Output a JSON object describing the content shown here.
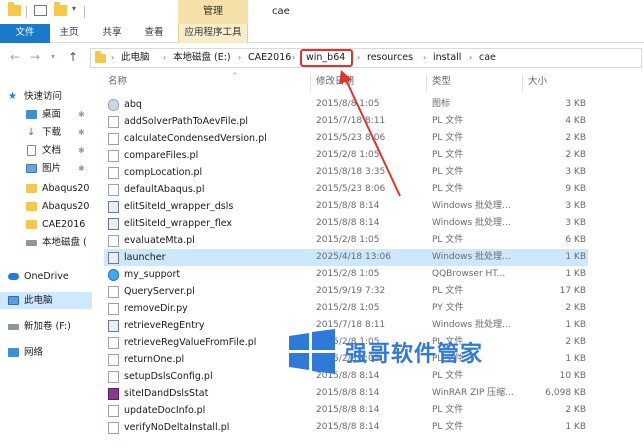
{
  "titlebar": {
    "context_group": "管理",
    "window_title": "cae"
  },
  "ribbon": {
    "tabs": [
      "文件",
      "主页",
      "共享",
      "查看",
      "应用程序工具"
    ]
  },
  "address": {
    "crumbs": [
      "此电脑",
      "本地磁盘 (E:)",
      "CAE2016",
      "win_b64",
      "resources",
      "install",
      "cae"
    ],
    "highlighted": "win_b64"
  },
  "columns": {
    "name": "名称",
    "date": "修改日期",
    "type": "类型",
    "size": "大小"
  },
  "nav": {
    "items": [
      {
        "label": "快速访问",
        "icon": "star-icon",
        "pinned": false
      },
      {
        "label": "桌面",
        "icon": "desktop-icon",
        "pinned": true
      },
      {
        "label": "下载",
        "icon": "download-icon",
        "pinned": true
      },
      {
        "label": "文档",
        "icon": "document-icon",
        "pinned": true
      },
      {
        "label": "图片",
        "icon": "picture-icon",
        "pinned": true
      },
      {
        "label": "Abaqus20",
        "icon": "folder-icon",
        "pinned": false
      },
      {
        "label": "Abaqus20",
        "icon": "folder-icon",
        "pinned": false
      },
      {
        "label": "CAE2016",
        "icon": "folder-icon",
        "pinned": false
      },
      {
        "label": "本地磁盘 (",
        "icon": "drive-icon",
        "pinned": false
      },
      {
        "label": "OneDrive",
        "icon": "cloud-icon",
        "pinned": false
      },
      {
        "label": "此电脑",
        "icon": "computer-icon",
        "pinned": false
      },
      {
        "label": "新加卷 (F:)",
        "icon": "drive-icon",
        "pinned": false
      },
      {
        "label": "网络",
        "icon": "network-icon",
        "pinned": false
      }
    ]
  },
  "files": [
    {
      "name": "abq",
      "date": "2015/8/8 1:05",
      "type": "图标",
      "size": "3 KB"
    },
    {
      "name": "addSolverPathToAevFile.pl",
      "date": "2015/7/18 8:11",
      "type": "PL 文件",
      "size": "4 KB"
    },
    {
      "name": "calculateCondensedVersion.pl",
      "date": "2015/5/23 8:06",
      "type": "PL 文件",
      "size": "2 KB"
    },
    {
      "name": "compareFiles.pl",
      "date": "2015/2/8 1:05",
      "type": "PL 文件",
      "size": "2 KB"
    },
    {
      "name": "compLocation.pl",
      "date": "2015/8/18 3:35",
      "type": "PL 文件",
      "size": "3 KB"
    },
    {
      "name": "defaultAbaqus.pl",
      "date": "2015/5/23 8:06",
      "type": "PL 文件",
      "size": "9 KB"
    },
    {
      "name": "elitSiteId_wrapper_dsls",
      "date": "2015/8/8 8:14",
      "type": "Windows 批处理...",
      "size": "3 KB"
    },
    {
      "name": "elitSiteId_wrapper_flex",
      "date": "2015/8/8 8:14",
      "type": "Windows 批处理...",
      "size": "3 KB"
    },
    {
      "name": "evaluateMta.pl",
      "date": "2015/2/8 1:05",
      "type": "PL 文件",
      "size": "6 KB"
    },
    {
      "name": "launcher",
      "date": "2025/4/18 13:06",
      "type": "Windows 批处理...",
      "size": "1 KB"
    },
    {
      "name": "my_support",
      "date": "2015/2/8 1:05",
      "type": "QQBrowser HT...",
      "size": "1 KB"
    },
    {
      "name": "QueryServer.pl",
      "date": "2015/9/19 7:32",
      "type": "PL 文件",
      "size": "17 KB"
    },
    {
      "name": "removeDir.py",
      "date": "2015/2/8 1:05",
      "type": "PY 文件",
      "size": "2 KB"
    },
    {
      "name": "retrieveRegEntry",
      "date": "2015/7/18 8:11",
      "type": "Windows 批处理...",
      "size": "1 KB"
    },
    {
      "name": "retrieveRegValueFromFile.pl",
      "date": "2015/2/8 1:05",
      "type": "PL 文件",
      "size": "2 KB"
    },
    {
      "name": "returnOne.pl",
      "date": "2015/2/8 1:05",
      "type": "PL 文件",
      "size": "1 KB"
    },
    {
      "name": "setupDslsConfig.pl",
      "date": "2015/8/8 8:14",
      "type": "PL 文件",
      "size": "10 KB"
    },
    {
      "name": "siteIDandDslsStat",
      "date": "2015/8/8 8:14",
      "type": "WinRAR ZIP 压缩...",
      "size": "6,098 KB"
    },
    {
      "name": "updateDocInfo.pl",
      "date": "2015/8/8 8:14",
      "type": "PL 文件",
      "size": "2 KB"
    },
    {
      "name": "verifyNoDeltaInstall.pl",
      "date": "2015/8/8 8:14",
      "type": "PL 文件",
      "size": "1 KB"
    }
  ],
  "selected_file": "launcher",
  "watermark": "强哥软件管家",
  "colors": {
    "accent": "#1979ca",
    "selection": "#cce8ff",
    "annotation": "#e0342a",
    "watermark": "#2f7ad9"
  }
}
